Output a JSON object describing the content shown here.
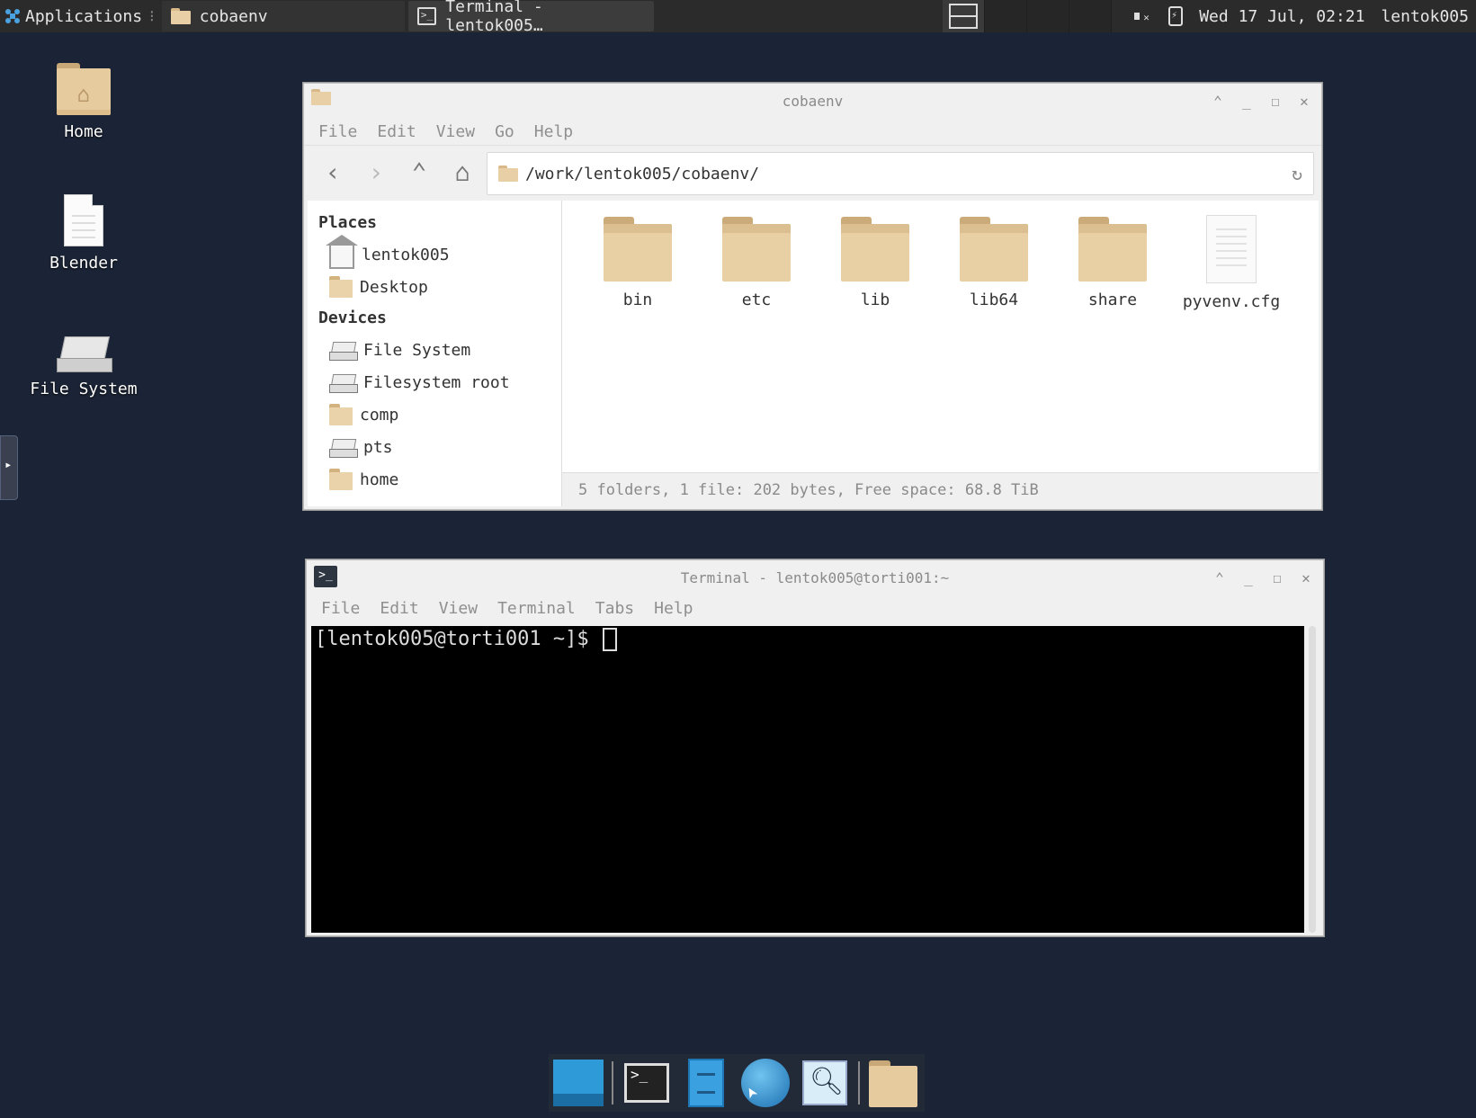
{
  "top_panel": {
    "applications_label": "Applications",
    "tasks": [
      {
        "label": "cobaenv",
        "icon": "folder-icon"
      },
      {
        "label": "Terminal - lentok005…",
        "icon": "terminal-icon"
      }
    ],
    "clock": "Wed 17 Jul, 02:21",
    "user": "lentok005"
  },
  "desktop": {
    "icons": [
      {
        "label": "Home",
        "icon": "home-folder-icon"
      },
      {
        "label": "Blender",
        "icon": "document-icon"
      },
      {
        "label": "File System",
        "icon": "drive-icon"
      }
    ]
  },
  "file_manager": {
    "title": "cobaenv",
    "menu": [
      "File",
      "Edit",
      "View",
      "Go",
      "Help"
    ],
    "address": "/work/lentok005/cobaenv/",
    "sidebar": {
      "places_heading": "Places",
      "places": [
        "lentok005",
        "Desktop"
      ],
      "devices_heading": "Devices",
      "devices": [
        "File System",
        "Filesystem root",
        "comp",
        "pts",
        "home"
      ]
    },
    "items": [
      "bin",
      "etc",
      "lib",
      "lib64",
      "share",
      "pyvenv.cfg"
    ],
    "status": "5 folders, 1 file: 202 bytes, Free space: 68.8 TiB"
  },
  "terminal": {
    "title": "Terminal - lentok005@torti001:~",
    "menu": [
      "File",
      "Edit",
      "View",
      "Terminal",
      "Tabs",
      "Help"
    ],
    "prompt": "[lentok005@torti001 ~]$"
  },
  "dock": {
    "items": [
      "show-desktop-icon",
      "terminal-icon",
      "file-manager-icon",
      "web-browser-icon",
      "app-finder-icon",
      "home-folder-icon"
    ]
  }
}
